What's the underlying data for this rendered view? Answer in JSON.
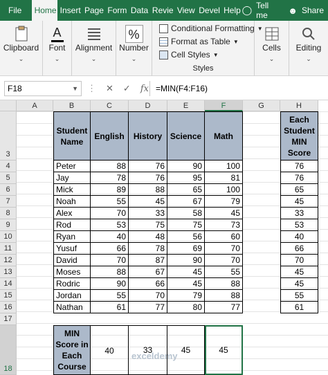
{
  "ribbon": {
    "tabs": [
      "File",
      "Home",
      "Insert",
      "Page",
      "Form",
      "Data",
      "Revie",
      "View",
      "Devel",
      "Help"
    ],
    "tell_me": "Tell me",
    "share": "Share",
    "groups": {
      "clipboard": "Clipboard",
      "font": "Font",
      "alignment": "Alignment",
      "number": "Number",
      "cells": "Cells",
      "editing": "Editing",
      "styles": "Styles"
    },
    "styles_items": [
      "Conditional Formatting",
      "Format as Table",
      "Cell Styles"
    ],
    "number_symbol": "%",
    "font_symbol": "A"
  },
  "formula_bar": {
    "name_box": "F18",
    "fx": "fx",
    "formula": "=MIN(F4:F16)"
  },
  "sheet": {
    "columns": [
      "A",
      "B",
      "C",
      "D",
      "E",
      "F",
      "G",
      "H"
    ],
    "rows": [
      "3",
      "4",
      "5",
      "6",
      "7",
      "8",
      "9",
      "10",
      "11",
      "12",
      "13",
      "14",
      "15",
      "16",
      "17",
      "18"
    ],
    "headers": {
      "name": "Student Name",
      "english": "English",
      "history": "History",
      "science": "Science",
      "math": "Math",
      "h_header": "Each Student MIN Score"
    },
    "students": [
      {
        "name": "Peter",
        "english": "88",
        "history": "76",
        "science": "90",
        "math": "100",
        "min": "76"
      },
      {
        "name": "Jay",
        "english": "78",
        "history": "76",
        "science": "95",
        "math": "81",
        "min": "76"
      },
      {
        "name": "Mick",
        "english": "89",
        "history": "88",
        "science": "65",
        "math": "100",
        "min": "65"
      },
      {
        "name": "Noah",
        "english": "55",
        "history": "45",
        "science": "67",
        "math": "79",
        "min": "45"
      },
      {
        "name": "Alex",
        "english": "70",
        "history": "33",
        "science": "58",
        "math": "45",
        "min": "33"
      },
      {
        "name": "Rod",
        "english": "53",
        "history": "75",
        "science": "75",
        "math": "73",
        "min": "53"
      },
      {
        "name": "Ryan",
        "english": "40",
        "history": "48",
        "science": "56",
        "math": "60",
        "min": "40"
      },
      {
        "name": "Yusuf",
        "english": "66",
        "history": "78",
        "science": "69",
        "math": "70",
        "min": "66"
      },
      {
        "name": "David",
        "english": "70",
        "history": "87",
        "science": "90",
        "math": "70",
        "min": "70"
      },
      {
        "name": "Moses",
        "english": "88",
        "history": "67",
        "science": "45",
        "math": "55",
        "min": "45"
      },
      {
        "name": "Rodric",
        "english": "90",
        "history": "66",
        "science": "45",
        "math": "88",
        "min": "45"
      },
      {
        "name": "Jordan",
        "english": "55",
        "history": "70",
        "science": "79",
        "math": "88",
        "min": "55"
      },
      {
        "name": "Nathan",
        "english": "61",
        "history": "77",
        "science": "80",
        "math": "77",
        "min": "61"
      }
    ],
    "min_row": {
      "label": "MIN Score in Each Course",
      "english": "40",
      "history": "33",
      "science": "45",
      "math": "45"
    },
    "watermark": "exceldemy"
  },
  "colors": {
    "accent": "#217346",
    "header_fill": "#acb9ca"
  }
}
